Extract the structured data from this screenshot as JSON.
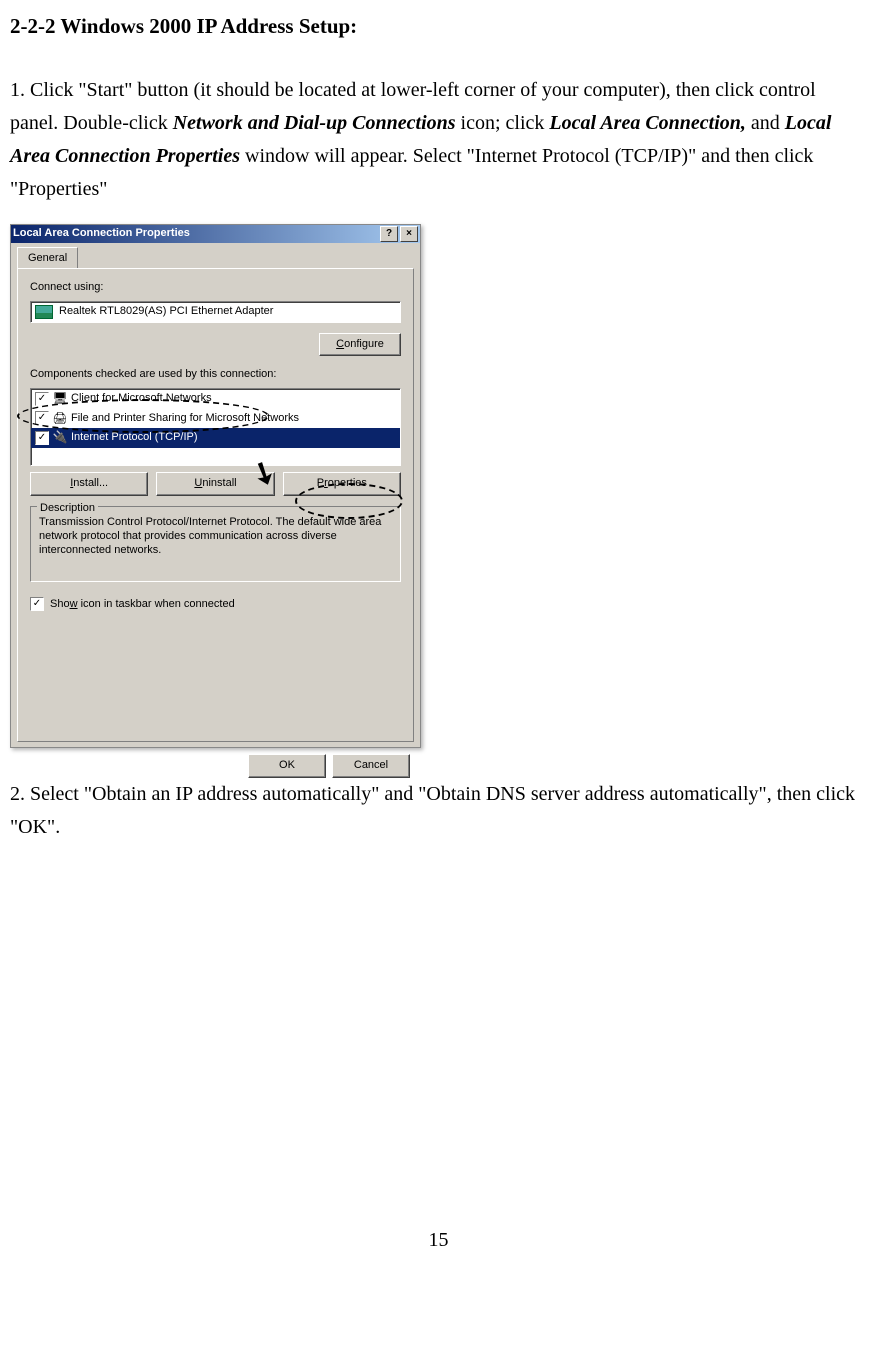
{
  "heading": "2-2-2 Windows 2000 IP Address Setup:",
  "para1": {
    "pre1": "1. Click \"Start\" button (it should be located at lower-left corner of your computer), then click control panel. Double-click ",
    "b1": "Network and Dial-up Connections",
    "mid1": " icon; click ",
    "b2": "Local Area Connection,",
    "mid2": " and ",
    "b3": "Local Area Connection Properties",
    "mid3": " window will appear. Select \"Internet Protocol (TCP/IP)\" and then click \"Properties\""
  },
  "dialog": {
    "title": "Local Area Connection Properties",
    "help": "?",
    "close": "×",
    "tab": "General",
    "connect_using": "Connect using:",
    "adapter": "Realtek RTL8029(AS) PCI Ethernet Adapter",
    "configure": "Configure",
    "configure_u": "C",
    "components_label": "Components checked are used by this connection:",
    "items": [
      {
        "label": "Client for Microsoft Networks"
      },
      {
        "label": "File and Printer Sharing for Microsoft Networks"
      },
      {
        "label": "Internet Protocol (TCP/IP)"
      }
    ],
    "install": "Install...",
    "install_u": "I",
    "uninstall": "Uninstall",
    "uninstall_u": "U",
    "properties": "Properties",
    "properties_u": "r",
    "desc_legend": "Description",
    "desc_text": "Transmission Control Protocol/Internet Protocol. The default wide area network protocol that provides communication across diverse interconnected networks.",
    "show_label_pre": "Sho",
    "show_label_u": "w",
    "show_label_post": " icon in taskbar when connected",
    "ok": "OK",
    "cancel": "Cancel"
  },
  "para2": "2. Select \"Obtain an IP address automatically\" and \"Obtain DNS server address automatically\", then click \"OK\".",
  "page_number": "15"
}
